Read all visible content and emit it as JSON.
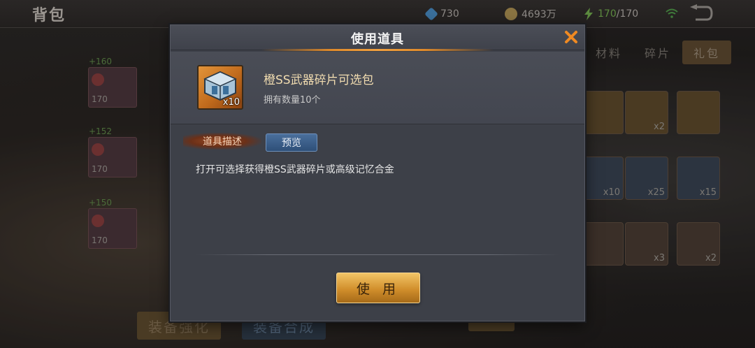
{
  "background": {
    "page_title": "背包",
    "resources": {
      "diamond": "730",
      "gold": "4693万",
      "energy_current": "170",
      "energy_max": "/170"
    },
    "tabs": [
      "材料",
      "碎片",
      "礼包"
    ],
    "left_cards": [
      {
        "plus": "+160",
        "level": "170"
      },
      {
        "plus": "+152",
        "level": "170"
      },
      {
        "plus": "+150",
        "level": "170"
      }
    ],
    "slots_row2_qty": [
      "",
      "x2",
      ""
    ],
    "slots_row3_qty": [
      "x10",
      "x25",
      "x15"
    ],
    "slots_row4_qty": [
      "",
      "x3",
      "x2"
    ],
    "bottom_buttons": {
      "enhance": "装备强化",
      "merge": "装备合成"
    }
  },
  "modal": {
    "title": "使用道具",
    "item": {
      "name": "橙SS武器碎片可选包",
      "owned_label": "拥有数量10个",
      "icon_qty": "x10"
    },
    "description_tag": "道具描述",
    "preview_button": "预览",
    "description": "打开可选择获得橙SS武器碎片或高级记忆合金",
    "use_button": "使 用"
  },
  "colors": {
    "accent_orange": "#f0a040",
    "close_orange": "#f08a22",
    "item_name": "#f1dcb0",
    "preview_blue": "#2e4f78",
    "use_gold": "#d18f2c"
  }
}
